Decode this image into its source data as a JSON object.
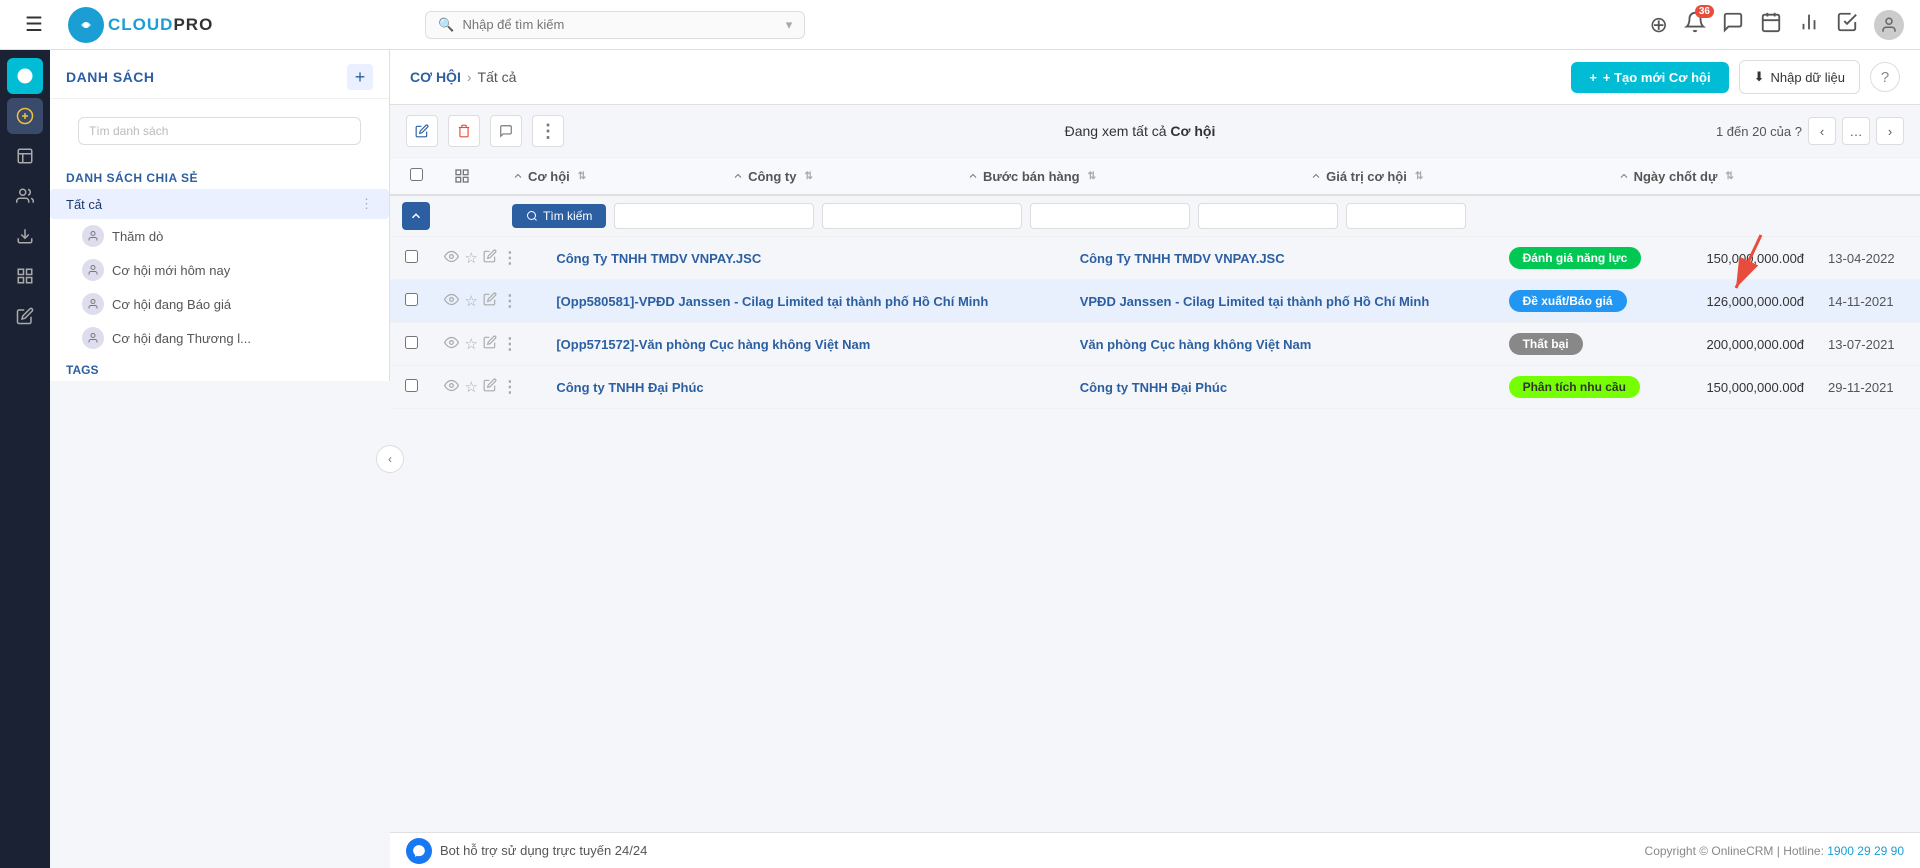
{
  "app": {
    "logo_text": "CLOUDPRO",
    "logo_abbr": "C"
  },
  "topbar": {
    "search_placeholder": "Nhập để tìm kiếm",
    "notification_count": "36"
  },
  "breadcrumb": {
    "parent": "CƠ HỘI",
    "separator": "›",
    "current": "Tất cả"
  },
  "header_buttons": {
    "create": "+ Tạo mới Cơ hội",
    "import": "Nhập dữ liệu"
  },
  "sidebar": {
    "list_title": "DANH SÁCH",
    "search_placeholder": "Tìm danh sách",
    "shared_title": "DANH SÁCH CHIA SẺ",
    "shared_active": "Tất cả",
    "sub_items": [
      "Thăm dò",
      "Cơ hội mới hôm nay",
      "Cơ hội đang Báo giá",
      "Cơ hội đang Thương l..."
    ],
    "tags_title": "TAGS"
  },
  "table": {
    "toolbar_text_before": "Đang xem tất cả ",
    "toolbar_highlight": "Cơ hội",
    "pagination": "1 đến 20 của ?",
    "columns": [
      "Cơ hội",
      "Công ty",
      "Bước bán hàng",
      "Giá trị cơ hội",
      "Ngày chốt dự"
    ],
    "search_btn": "Tìm kiếm",
    "rows": [
      {
        "id": 1,
        "opportunity": "Công Ty TNHH TMDV VNPAY.JSC",
        "company": "Công Ty TNHH TMDV VNPAY.JSC",
        "stage": "Đánh giá năng lực",
        "stage_color": "status-green",
        "value": "150,000,000.00đ",
        "date": "13-04-2022",
        "highlighted": false
      },
      {
        "id": 2,
        "opportunity": "[Opp580581]-VPĐD Janssen - Cilag Limited tại thành phố Hồ Chí Minh",
        "company": "VPĐD Janssen - Cilag Limited tại thành phố Hồ Chí Minh",
        "stage": "Đề xuất/Báo giá",
        "stage_color": "status-blue",
        "value": "126,000,000.00đ",
        "date": "14-11-2021",
        "highlighted": true
      },
      {
        "id": 3,
        "opportunity": "[Opp571572]-Văn phòng Cục hàng không Việt Nam",
        "company": "Văn phòng Cục hàng không Việt Nam",
        "stage": "Thất bại",
        "stage_color": "status-gray",
        "value": "200,000,000.00đ",
        "date": "13-07-2021",
        "highlighted": false
      },
      {
        "id": 4,
        "opportunity": "Công ty TNHH Đại Phúc",
        "company": "Công ty TNHH Đại Phúc",
        "stage": "Phân tích nhu cầu",
        "stage_color": "status-lime",
        "value": "150,000,000.00đ",
        "date": "29-11-2021",
        "highlighted": false
      }
    ]
  },
  "footer": {
    "chat_text": "Bot hỗ trợ sử dụng trực tuyến 24/24",
    "copyright": "Copyright © OnlineCRM | Hotline: ",
    "hotline": "1900 29 29 90"
  },
  "icons": {
    "menu": "☰",
    "plus_circle": "⊕",
    "bell": "🔔",
    "chat_bubble": "💬",
    "calendar": "📅",
    "chart": "📊",
    "checkbox": "☑",
    "user": "👤",
    "pencil": "✏",
    "trash": "🗑",
    "comment": "💬",
    "more": "⋮",
    "eye": "👁",
    "star": "☆",
    "sort": "⇅",
    "chevron_left": "‹",
    "chevron_right": "›",
    "ellipsis": "…",
    "search": "🔍",
    "grid": "⊞",
    "download": "⬇",
    "help": "?",
    "collapse": "‹",
    "messenger": "m"
  }
}
